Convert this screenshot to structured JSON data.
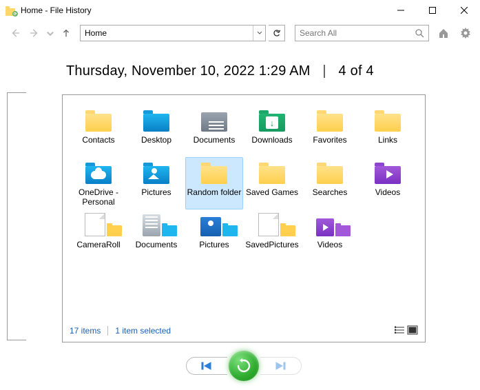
{
  "window": {
    "title": "Home - File History"
  },
  "toolbar": {
    "location": "Home",
    "search_placeholder": "Search All"
  },
  "header": {
    "timestamp": "Thursday, November 10, 2022 1:29 AM",
    "separator": "|",
    "position": "4 of 4"
  },
  "items": [
    {
      "label": "Contacts",
      "icon": "folder-yellow",
      "selected": false
    },
    {
      "label": "Desktop",
      "icon": "folder-blue",
      "selected": false
    },
    {
      "label": "Documents",
      "icon": "folder-grey-doc",
      "selected": false
    },
    {
      "label": "Downloads",
      "icon": "folder-green-dl",
      "selected": false
    },
    {
      "label": "Favorites",
      "icon": "folder-yellow",
      "selected": false
    },
    {
      "label": "Links",
      "icon": "folder-yellow",
      "selected": false
    },
    {
      "label": "OneDrive - Personal",
      "icon": "folder-blue-cloud",
      "selected": false
    },
    {
      "label": "Pictures",
      "icon": "folder-blue-pic",
      "selected": false
    },
    {
      "label": "Random folder",
      "icon": "folder-yellow",
      "selected": true
    },
    {
      "label": "Saved Games",
      "icon": "folder-yellow",
      "selected": false
    },
    {
      "label": "Searches",
      "icon": "folder-yellow",
      "selected": false
    },
    {
      "label": "Videos",
      "icon": "folder-purple-vid",
      "selected": false
    },
    {
      "label": "CameraRoll",
      "icon": "lib-cameraroll",
      "selected": false
    },
    {
      "label": "Documents",
      "icon": "lib-documents",
      "selected": false
    },
    {
      "label": "Pictures",
      "icon": "lib-pictures",
      "selected": false
    },
    {
      "label": "SavedPictures",
      "icon": "lib-savedpics",
      "selected": false
    },
    {
      "label": "Videos",
      "icon": "lib-videos",
      "selected": false
    }
  ],
  "status": {
    "count_label": "17 items",
    "selection_label": "1 item selected"
  }
}
